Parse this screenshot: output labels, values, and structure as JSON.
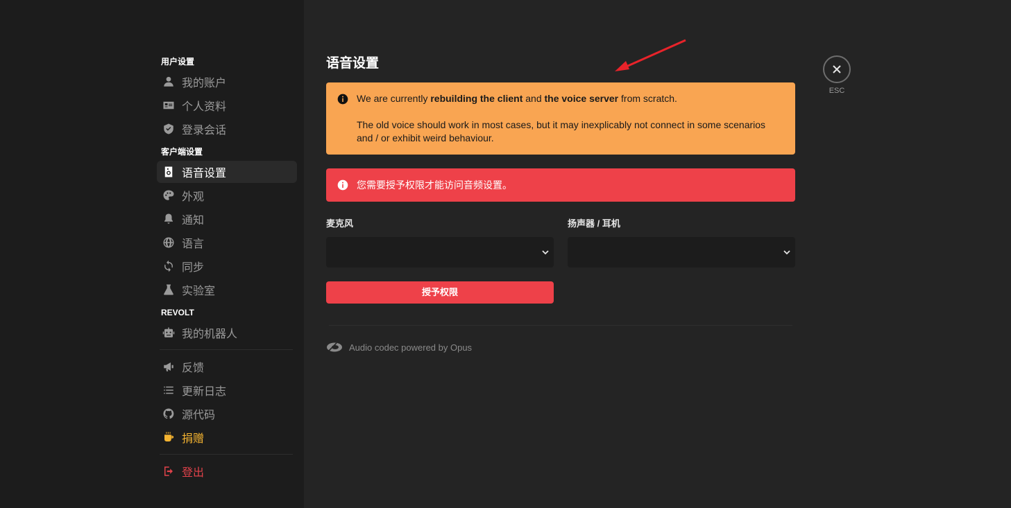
{
  "sidebar": {
    "sections": [
      {
        "title": "用户设置",
        "items": [
          {
            "label": "我的账户",
            "icon": "user-icon"
          },
          {
            "label": "个人资料",
            "icon": "id-card-icon"
          },
          {
            "label": "登录会话",
            "icon": "shield-check-icon"
          }
        ]
      },
      {
        "title": "客户端设置",
        "items": [
          {
            "label": "语音设置",
            "icon": "speaker-icon",
            "active": true
          },
          {
            "label": "外观",
            "icon": "palette-icon"
          },
          {
            "label": "通知",
            "icon": "bell-icon"
          },
          {
            "label": "语言",
            "icon": "globe-icon"
          },
          {
            "label": "同步",
            "icon": "sync-icon"
          },
          {
            "label": "实验室",
            "icon": "flask-icon"
          }
        ]
      },
      {
        "title": "REVOLT",
        "items": [
          {
            "label": "我的机器人",
            "icon": "robot-icon"
          }
        ]
      }
    ],
    "extra_items": [
      {
        "label": "反馈",
        "icon": "megaphone-icon"
      },
      {
        "label": "更新日志",
        "icon": "list-icon"
      },
      {
        "label": "源代码",
        "icon": "github-icon"
      },
      {
        "label": "捐赠",
        "icon": "coffee-icon"
      }
    ],
    "logout_label": "登出"
  },
  "main": {
    "title": "语音设置",
    "warning": {
      "line1_part1": "We are currently ",
      "line1_bold1": "rebuilding the client",
      "line1_part2": " and ",
      "line1_bold2": "the voice server",
      "line1_part3": " from scratch.",
      "line2": "The old voice should work in most cases, but it may inexplicably not connect in some scenarios and / or exhibit weird behaviour."
    },
    "error": "您需要授予权限才能访问音频设置。",
    "microphone_label": "麦克风",
    "speaker_label": "扬声器 / 耳机",
    "grant_button": "授予权限",
    "opus_text": "Audio codec powered by Opus"
  },
  "close": {
    "esc_label": "ESC"
  },
  "colors": {
    "sidebar_bg": "#1c1c1c",
    "content_bg": "#242424",
    "warning_bg": "#f9a552",
    "error_bg": "#ee4149",
    "donate": "#f5b431",
    "logout": "#e0424a"
  }
}
